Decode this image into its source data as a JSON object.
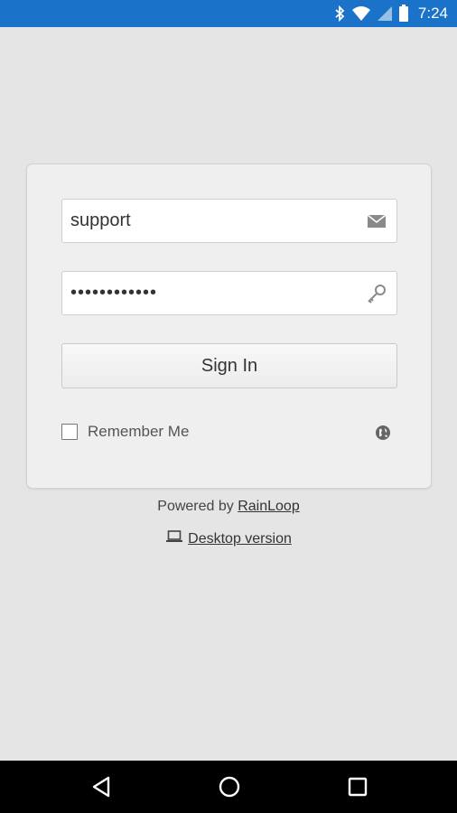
{
  "status_bar": {
    "time": "7:24",
    "icons": [
      "bluetooth-icon",
      "wifi-icon",
      "signal-icon",
      "battery-icon"
    ],
    "background": "#1a73c9"
  },
  "login": {
    "login_value": "support",
    "login_icon": "envelope-icon",
    "password_value": "••••••••••••",
    "password_icon": "key-icon",
    "sign_in_label": "Sign In",
    "remember_label": "Remember Me",
    "remember_checked": false,
    "language_icon": "globe-icon"
  },
  "footer": {
    "powered_prefix": "Powered by ",
    "powered_link": "RainLoop",
    "desktop_label": "Desktop version",
    "desktop_icon": "laptop-icon"
  },
  "nav_bar": {
    "icons": [
      "back-icon",
      "home-icon",
      "recents-icon"
    ]
  }
}
